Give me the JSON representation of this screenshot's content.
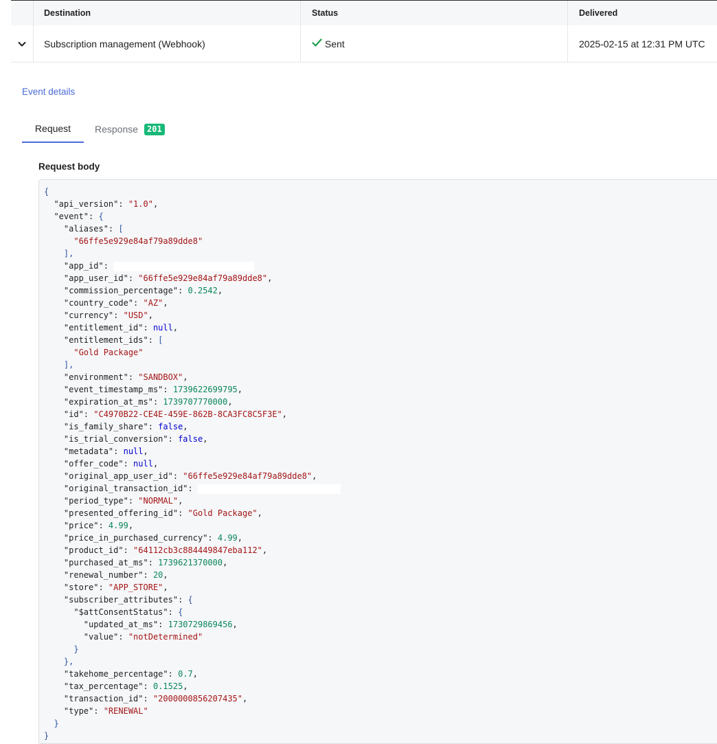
{
  "table": {
    "headers": [
      "Destination",
      "Status",
      "Delivered"
    ],
    "row": {
      "destination": "Subscription management (Webhook)",
      "status": "Sent",
      "delivered": "2025-02-15 at 12:31 PM UTC"
    }
  },
  "event_details_label": "Event details",
  "tabs": {
    "request": "Request",
    "response": "Response",
    "response_code": "201"
  },
  "request_body_label": "Request body",
  "colors": {
    "accent": "#4a6bd6",
    "success": "#17b978",
    "string": "#a31515",
    "number": "#098658",
    "keyword": "#0000cc"
  },
  "code_lines": [
    [
      [
        "br",
        "{"
      ]
    ],
    [
      [
        "k",
        "  \"api_version\": "
      ],
      [
        "s",
        "\"1.0\""
      ],
      [
        "k",
        ","
      ]
    ],
    [
      [
        "k",
        "  \"event\": "
      ],
      [
        "br",
        "{"
      ]
    ],
    [
      [
        "k",
        "    \"aliases\": "
      ],
      [
        "br",
        "["
      ]
    ],
    [
      [
        "s",
        "      \"66ffe5e929e84af79a89dde8\""
      ]
    ],
    [
      [
        "br",
        "    ],"
      ]
    ],
    [
      [
        "k",
        "    \"app_id\": "
      ],
      [
        "r",
        "205"
      ]
    ],
    [
      [
        "k",
        "    \"app_user_id\": "
      ],
      [
        "s",
        "\"66ffe5e929e84af79a89dde8\""
      ],
      [
        "k",
        ","
      ]
    ],
    [
      [
        "k",
        "    \"commission_percentage\": "
      ],
      [
        "n",
        "0.2542"
      ],
      [
        "k",
        ","
      ]
    ],
    [
      [
        "k",
        "    \"country_code\": "
      ],
      [
        "s",
        "\"AZ\""
      ],
      [
        "k",
        ","
      ]
    ],
    [
      [
        "k",
        "    \"currency\": "
      ],
      [
        "s",
        "\"USD\""
      ],
      [
        "k",
        ","
      ]
    ],
    [
      [
        "k",
        "    \"entitlement_id\": "
      ],
      [
        "b",
        "null"
      ],
      [
        "k",
        ","
      ]
    ],
    [
      [
        "k",
        "    \"entitlement_ids\": "
      ],
      [
        "br",
        "["
      ]
    ],
    [
      [
        "s",
        "      \"Gold Package\""
      ]
    ],
    [
      [
        "br",
        "    ],"
      ]
    ],
    [
      [
        "k",
        "    \"environment\": "
      ],
      [
        "s",
        "\"SANDBOX\""
      ],
      [
        "k",
        ","
      ]
    ],
    [
      [
        "k",
        "    \"event_timestamp_ms\": "
      ],
      [
        "n",
        "1739622699795"
      ],
      [
        "k",
        ","
      ]
    ],
    [
      [
        "k",
        "    \"expiration_at_ms\": "
      ],
      [
        "n",
        "1739707770000"
      ],
      [
        "k",
        ","
      ]
    ],
    [
      [
        "k",
        "    \"id\": "
      ],
      [
        "s",
        "\"C4970B22-CE4E-459E-862B-8CA3FC8C5F3E\""
      ],
      [
        "k",
        ","
      ]
    ],
    [
      [
        "k",
        "    \"is_family_share\": "
      ],
      [
        "b",
        "false"
      ],
      [
        "k",
        ","
      ]
    ],
    [
      [
        "k",
        "    \"is_trial_conversion\": "
      ],
      [
        "b",
        "false"
      ],
      [
        "k",
        ","
      ]
    ],
    [
      [
        "k",
        "    \"metadata\": "
      ],
      [
        "b",
        "null"
      ],
      [
        "k",
        ","
      ]
    ],
    [
      [
        "k",
        "    \"offer_code\": "
      ],
      [
        "b",
        "null"
      ],
      [
        "k",
        ","
      ]
    ],
    [
      [
        "k",
        "    \"original_app_user_id\": "
      ],
      [
        "s",
        "\"66ffe5e929e84af79a89dde8\""
      ],
      [
        "k",
        ","
      ]
    ],
    [
      [
        "k",
        "    \"original_transaction_id\": "
      ],
      [
        "r",
        "208"
      ]
    ],
    [
      [
        "k",
        "    \"period_type\": "
      ],
      [
        "s",
        "\"NORMAL\""
      ],
      [
        "k",
        ","
      ]
    ],
    [
      [
        "k",
        "    \"presented_offering_id\": "
      ],
      [
        "s",
        "\"Gold Package\""
      ],
      [
        "k",
        ","
      ]
    ],
    [
      [
        "k",
        "    \"price\": "
      ],
      [
        "n",
        "4.99"
      ],
      [
        "k",
        ","
      ]
    ],
    [
      [
        "k",
        "    \"price_in_purchased_currency\": "
      ],
      [
        "n",
        "4.99"
      ],
      [
        "k",
        ","
      ]
    ],
    [
      [
        "k",
        "    \"product_id\": "
      ],
      [
        "s",
        "\"64112cb3c884449847eba112\""
      ],
      [
        "k",
        ","
      ]
    ],
    [
      [
        "k",
        "    \"purchased_at_ms\": "
      ],
      [
        "n",
        "1739621370000"
      ],
      [
        "k",
        ","
      ]
    ],
    [
      [
        "k",
        "    \"renewal_number\": "
      ],
      [
        "n",
        "20"
      ],
      [
        "k",
        ","
      ]
    ],
    [
      [
        "k",
        "    \"store\": "
      ],
      [
        "s",
        "\"APP_STORE\""
      ],
      [
        "k",
        ","
      ]
    ],
    [
      [
        "k",
        "    \"subscriber_attributes\": "
      ],
      [
        "br",
        "{"
      ]
    ],
    [
      [
        "k",
        "      \"$attConsentStatus\": "
      ],
      [
        "br",
        "{"
      ]
    ],
    [
      [
        "k",
        "        \"updated_at_ms\": "
      ],
      [
        "n",
        "1730729869456"
      ],
      [
        "k",
        ","
      ]
    ],
    [
      [
        "k",
        "        \"value\": "
      ],
      [
        "s",
        "\"notDetermined\""
      ]
    ],
    [
      [
        "br",
        "      }"
      ]
    ],
    [
      [
        "br",
        "    },"
      ]
    ],
    [
      [
        "k",
        "    \"takehome_percentage\": "
      ],
      [
        "n",
        "0.7"
      ],
      [
        "k",
        ","
      ]
    ],
    [
      [
        "k",
        "    \"tax_percentage\": "
      ],
      [
        "n",
        "0.1525"
      ],
      [
        "k",
        ","
      ]
    ],
    [
      [
        "k",
        "    \"transaction_id\": "
      ],
      [
        "s",
        "\"2000000856207435\""
      ],
      [
        "k",
        ","
      ]
    ],
    [
      [
        "k",
        "    \"type\": "
      ],
      [
        "s",
        "\"RENEWAL\""
      ]
    ],
    [
      [
        "br",
        "  }"
      ]
    ],
    [
      [
        "br",
        "}"
      ]
    ]
  ]
}
